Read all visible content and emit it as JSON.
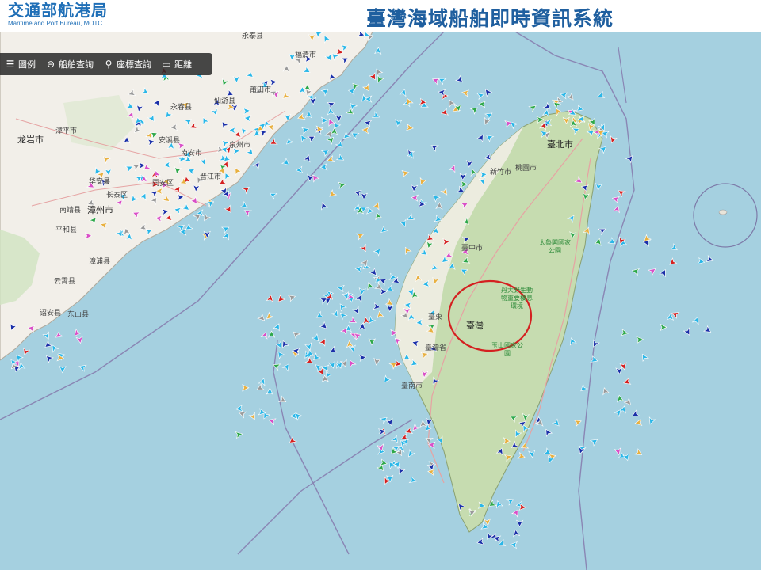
{
  "header": {
    "logo_zh": "交通部航港局",
    "logo_en": "Maritime and Port Bureau, MOTC",
    "system_title": "臺灣海域船舶即時資訊系統"
  },
  "toolbar": {
    "items": [
      {
        "icon": "list-icon",
        "glyph": "☰",
        "label": "圖例"
      },
      {
        "icon": "search-icon",
        "glyph": "⊖",
        "label": "船舶查詢"
      },
      {
        "icon": "location-search-icon",
        "glyph": "⚲",
        "label": "座標查詢"
      },
      {
        "icon": "ruler-icon",
        "glyph": "▭",
        "label": "距離"
      }
    ]
  },
  "map": {
    "taiwan_label": "臺灣",
    "place_labels": [
      {
        "name": "永泰县"
      },
      {
        "name": "福清市"
      },
      {
        "name": "莆田市"
      },
      {
        "name": "仙游县"
      },
      {
        "name": "永春县"
      },
      {
        "name": "安溪县"
      },
      {
        "name": "南安市"
      },
      {
        "name": "晋江市"
      },
      {
        "name": "同安区"
      },
      {
        "name": "长泰区"
      },
      {
        "name": "漳州市"
      },
      {
        "name": "龙岩市"
      },
      {
        "name": "华安县"
      },
      {
        "name": "南靖县"
      },
      {
        "name": "平和县"
      },
      {
        "name": "漳浦县"
      },
      {
        "name": "云霄县"
      },
      {
        "name": "东山县"
      },
      {
        "name": "诏安县"
      },
      {
        "name": "漳平市"
      },
      {
        "name": "泉州市"
      },
      {
        "name": "臺北市"
      },
      {
        "name": "桃園市"
      },
      {
        "name": "臺中市"
      },
      {
        "name": "臺灣"
      },
      {
        "name": "臺南市"
      },
      {
        "name": "臺灣省"
      },
      {
        "name": "臺東"
      },
      {
        "name": "新竹市"
      }
    ],
    "park_labels": [
      {
        "name": "太魯閣國家公園"
      },
      {
        "name": "丹大野生動物重要棲息環境"
      },
      {
        "name": "玉山國家公園"
      }
    ],
    "highlight_circle_color": "#d42020",
    "ship_colors": [
      "#2ab7e8",
      "#1a2fa8",
      "#d94fc7",
      "#9a9a9a",
      "#e8b040",
      "#d42020",
      "#2ea84a"
    ]
  }
}
